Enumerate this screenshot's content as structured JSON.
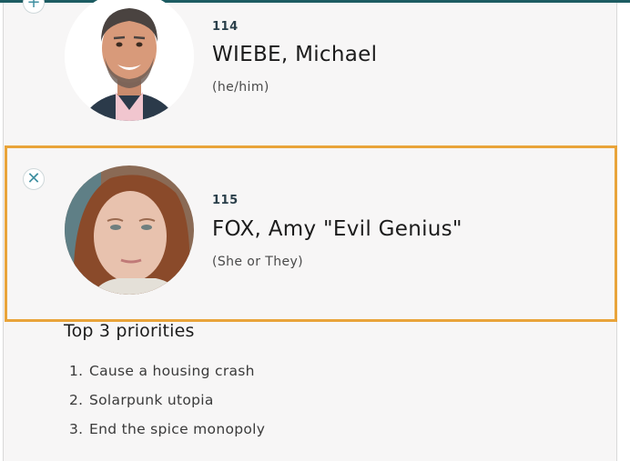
{
  "candidates": [
    {
      "number": "114",
      "name": "WIEBE, Michael",
      "pronouns": "(he/him)",
      "toggle_icon": "plus-icon",
      "selected": false
    },
    {
      "number": "115",
      "name": "FOX, Amy \"Evil Genius\"",
      "pronouns": "(She or They)",
      "toggle_icon": "close-icon",
      "selected": true
    }
  ],
  "priorities": {
    "title": "Top 3 priorities",
    "items": [
      {
        "idx": "1.",
        "text": "Cause a housing crash"
      },
      {
        "idx": "2.",
        "text": "Solarpunk utopia"
      },
      {
        "idx": "3.",
        "text": "End the spice monopoly"
      }
    ]
  },
  "colors": {
    "accent_bar": "#1d5c62",
    "selected_border": "#e9a43a",
    "toggle_icon": "#3f8fa0",
    "panel_bg": "#f7f6f6"
  }
}
